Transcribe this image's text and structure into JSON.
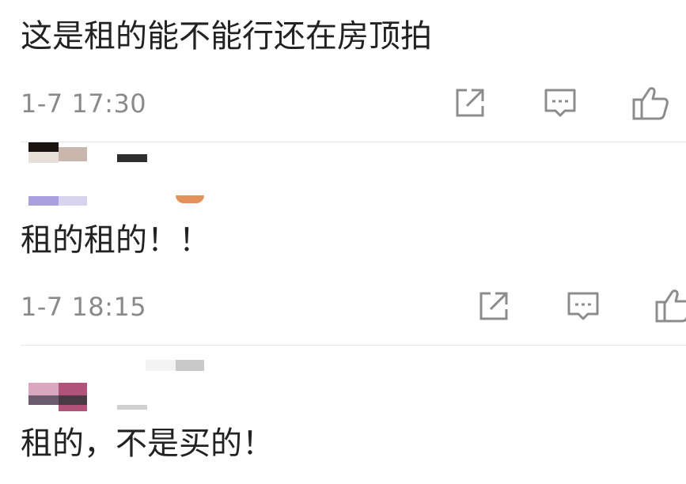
{
  "comments": [
    {
      "text": "这是租的能不能行还在房顶拍",
      "time": "1-7 17:30",
      "share_icon": "share-icon",
      "reply_icon": "comment-icon",
      "like_icon": "thumbs-up-icon"
    },
    {
      "text": "租的租的！！",
      "time": "1-7 18:15",
      "share_icon": "share-icon",
      "reply_icon": "comment-icon",
      "like_icon": "thumbs-up-icon"
    },
    {
      "text": "租的，不是买的！"
    }
  ],
  "colors": {
    "text": "#222222",
    "meta": "#8a8a8a",
    "icon": "#8c8c8c",
    "divider": "#e6e6e6"
  }
}
